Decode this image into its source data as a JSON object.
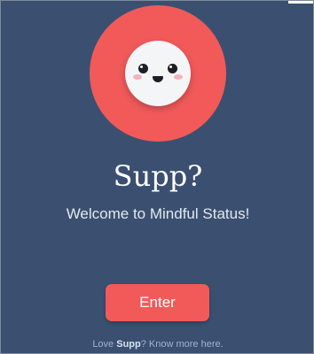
{
  "app": {
    "title": "Supp?",
    "subtitle": "Welcome to Mindful Status!"
  },
  "logo": {
    "icon": "smiley-face-icon",
    "circle_color": "#f25a5a"
  },
  "actions": {
    "enter_label": "Enter"
  },
  "footer": {
    "prefix": "Love ",
    "brand": "Supp",
    "link_text": "? Know more here."
  },
  "colors": {
    "background": "#3b5070",
    "accent": "#f25a5a",
    "text": "#ffffff"
  }
}
